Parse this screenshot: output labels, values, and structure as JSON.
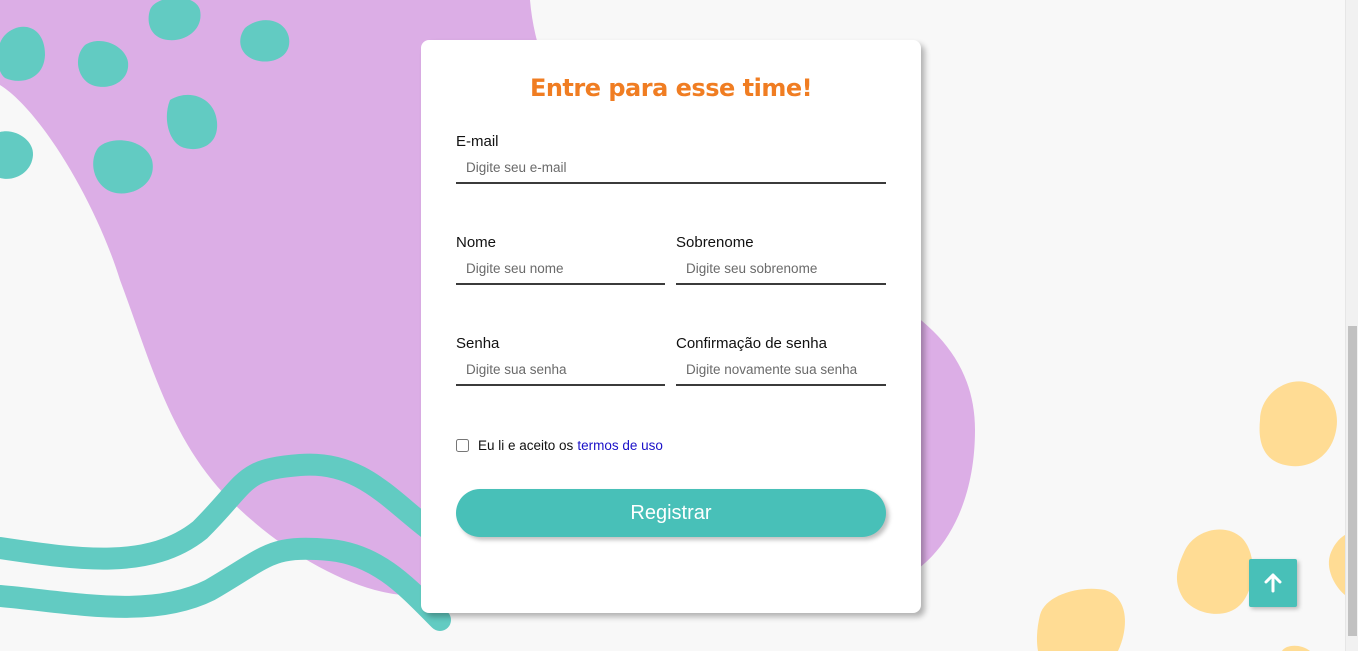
{
  "form": {
    "title": "Entre para esse time!",
    "email": {
      "label": "E-mail",
      "placeholder": "Digite seu e-mail"
    },
    "first_name": {
      "label": "Nome",
      "placeholder": "Digite seu nome"
    },
    "last_name": {
      "label": "Sobrenome",
      "placeholder": "Digite seu sobrenome"
    },
    "password": {
      "label": "Senha",
      "placeholder": "Digite sua senha"
    },
    "password_confirm": {
      "label": "Confirmação de senha",
      "placeholder": "Digite novamente sua senha"
    },
    "terms": {
      "prefix": "Eu li e aceito os",
      "link_text": "termos de uso",
      "checked": false
    },
    "submit_label": "Registrar"
  },
  "scroll_top_icon": "arrow-up-icon",
  "colors": {
    "accent": "#48c0b8",
    "title": "#f07d22",
    "purple_blob": "#dcaee6",
    "teal_blob": "#62cbc2",
    "yellow_blob": "#ffdc94",
    "link": "#1a10c8"
  }
}
